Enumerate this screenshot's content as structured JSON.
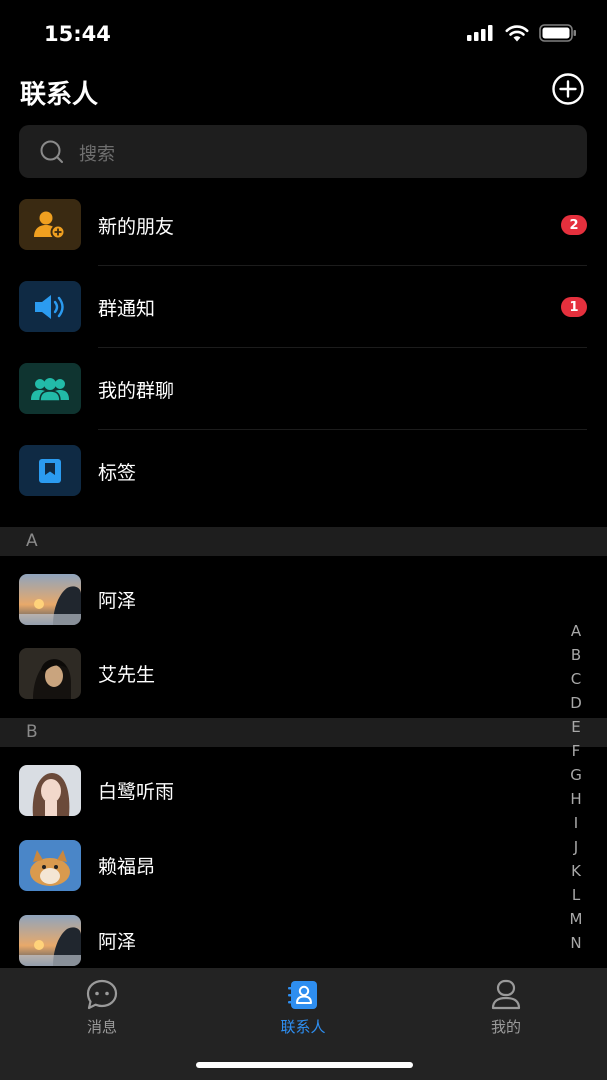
{
  "status": {
    "time": "15:44"
  },
  "header": {
    "title": "联系人"
  },
  "search": {
    "placeholder": "搜索"
  },
  "functions": [
    {
      "label": "新的朋友",
      "badge": "2",
      "icon": "add-user-icon",
      "color": "#f0a020"
    },
    {
      "label": "群通知",
      "badge": "1",
      "icon": "speaker-icon",
      "color": "#1e90e6"
    },
    {
      "label": "我的群聊",
      "icon": "group-icon",
      "color": "#22bba8"
    },
    {
      "label": "标签",
      "icon": "bookmark-icon",
      "color": "#1e90e6"
    }
  ],
  "sections": [
    {
      "letter": "A",
      "contacts": [
        "阿泽",
        "艾先生"
      ]
    },
    {
      "letter": "B",
      "contacts": [
        "白鹭听雨",
        "赖福昂",
        "阿泽"
      ]
    }
  ],
  "alpha_index": [
    "A",
    "B",
    "C",
    "D",
    "E",
    "F",
    "G",
    "H",
    "I",
    "J",
    "K",
    "L",
    "M",
    "N"
  ],
  "tabbar": {
    "tabs": [
      {
        "label": "消息",
        "icon": "chat-bubble-icon"
      },
      {
        "label": "联系人",
        "icon": "contacts-icon",
        "active": true
      },
      {
        "label": "我的",
        "icon": "profile-icon"
      }
    ]
  },
  "colors": {
    "accent": "#2e8ef0",
    "badge": "#e5303d"
  }
}
